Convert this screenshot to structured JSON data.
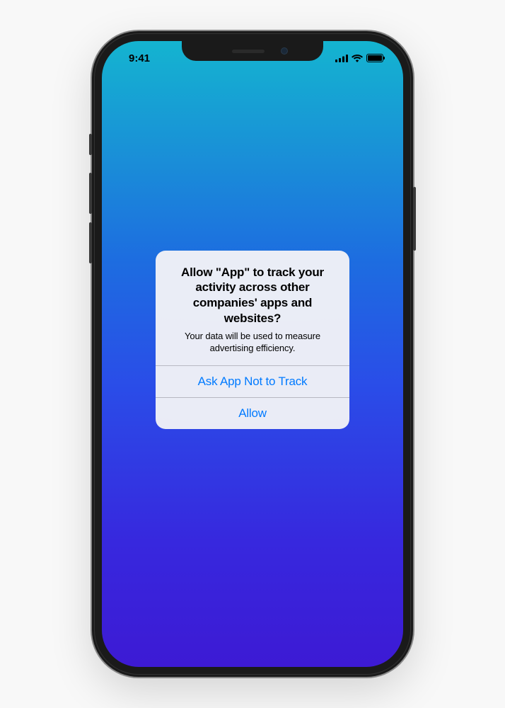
{
  "status_bar": {
    "time": "9:41"
  },
  "dialog": {
    "title": "Allow \"App\" to track your activity across other companies' apps and websites?",
    "subtitle": "Your data will be used to measure advertising efficiency.",
    "button_deny": "Ask App Not to Track",
    "button_allow": "Allow"
  }
}
